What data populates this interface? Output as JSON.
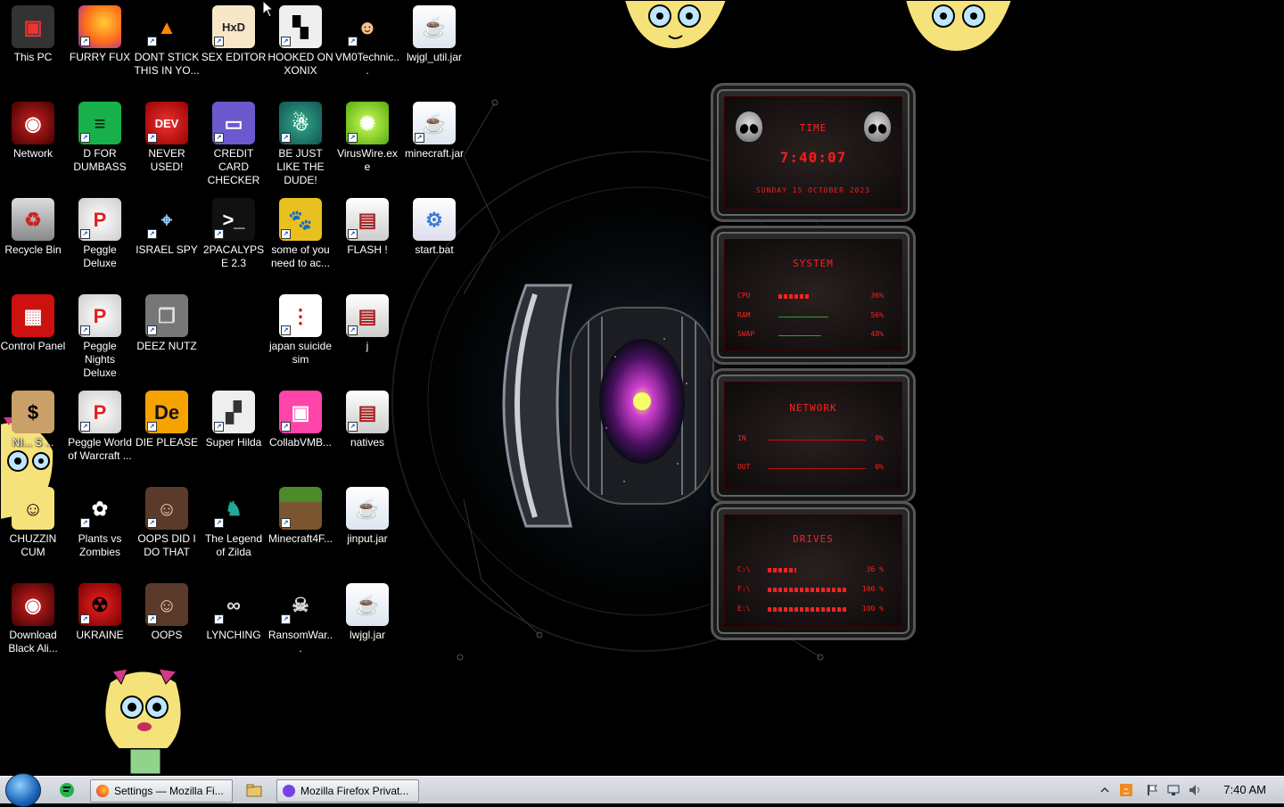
{
  "desktop": {
    "icons": [
      {
        "label": "This PC",
        "glyph": "pc-icon"
      },
      {
        "label": "FURRY FUX",
        "glyph": "firefox-icon"
      },
      {
        "label": "DONT STICK THIS IN YO...",
        "glyph": "vlc-icon"
      },
      {
        "label": "SEX EDITOR",
        "glyph": "hxd-icon"
      },
      {
        "label": "HOOKED ON XONIX",
        "glyph": "xonix-icon"
      },
      {
        "label": "VM0Technic...",
        "glyph": "doctor-icon"
      },
      {
        "label": "lwjgl_util.jar",
        "glyph": "java-icon"
      },
      {
        "label": "Network",
        "glyph": "alien-icon"
      },
      {
        "label": "D FOR DUMBASS",
        "glyph": "notepad-icon"
      },
      {
        "label": "NEVER USED!",
        "glyph": "devcpp-icon"
      },
      {
        "label": "CREDIT CARD CHECKER",
        "glyph": "card-icon"
      },
      {
        "label": "BE JUST LIKE THE DUDE!",
        "glyph": "santa-icon"
      },
      {
        "label": "VirusWire.exe",
        "glyph": "lime-icon"
      },
      {
        "label": "minecraft.jar",
        "glyph": "java-icon"
      },
      {
        "label": "Recycle Bin",
        "glyph": "recycle-bin-icon"
      },
      {
        "label": "Peggle Deluxe",
        "glyph": "peggle-icon"
      },
      {
        "label": "ISRAEL SPY",
        "glyph": "spy-icon"
      },
      {
        "label": "2PACALYPSE 2.3",
        "glyph": "terminal-icon"
      },
      {
        "label": "some of you need to ac...",
        "glyph": "beaver-icon"
      },
      {
        "label": "FLASH !",
        "glyph": "folder-icon"
      },
      {
        "label": "start.bat",
        "glyph": "gear-icon"
      },
      {
        "label": "Control Panel",
        "glyph": "control-panel-icon"
      },
      {
        "label": "Peggle Nights Deluxe",
        "glyph": "peggle-icon"
      },
      {
        "label": "DEEZ NUTZ",
        "glyph": "copies-icon"
      },
      {
        "label": "japan suicide sim",
        "glyph": "document-icon"
      },
      {
        "label": "j",
        "glyph": "folder-icon"
      },
      {
        "label": "NI... S ...",
        "glyph": "money-icon"
      },
      {
        "label": "Peggle World of Warcraft ...",
        "glyph": "peggle-icon"
      },
      {
        "label": "DIE PLEASE",
        "glyph": "de-icon"
      },
      {
        "label": "Super Hilda",
        "glyph": "pixel-icon"
      },
      {
        "label": "CollabVMB...",
        "glyph": "computer-icon"
      },
      {
        "label": "natives",
        "glyph": "folder-icon"
      },
      {
        "label": "CHUZZIN CUM",
        "glyph": "chuzzle-icon"
      },
      {
        "label": "Plants vs Zombies",
        "glyph": "flower-icon"
      },
      {
        "label": "OOPS DID I DO THAT",
        "glyph": "portrait-icon"
      },
      {
        "label": "The Legend of Zilda",
        "glyph": "elf-icon"
      },
      {
        "label": "Minecraft4F...",
        "glyph": "grass-block-icon"
      },
      {
        "label": "jinput.jar",
        "glyph": "java-icon"
      },
      {
        "label": "Download Black Ali...",
        "glyph": "alien-icon"
      },
      {
        "label": "UKRAINE",
        "glyph": "radiation-icon"
      },
      {
        "label": "OOPS",
        "glyph": "portrait-icon"
      },
      {
        "label": "LYNCHING",
        "glyph": "knot-icon"
      },
      {
        "label": "RansomWar...",
        "glyph": "skull-icon"
      },
      {
        "label": "lwjgl.jar",
        "glyph": "java-icon"
      }
    ]
  },
  "gadget": {
    "time_title": "TIME",
    "time": "7:40:07",
    "date": "SUNDAY 15 OCTOBER 2023",
    "system_title": "SYSTEM",
    "system": [
      {
        "label": "CPU",
        "value": "36%",
        "level": 0.36
      },
      {
        "label": "RAM",
        "value": "56%",
        "level": 0.56
      },
      {
        "label": "SWAP",
        "value": "48%",
        "level": 0.48
      }
    ],
    "network_title": "NETWORK",
    "network": [
      {
        "label": "IN",
        "value": "0%"
      },
      {
        "label": "OUT",
        "value": "0%"
      }
    ],
    "drives_title": "DRIVES",
    "drives": [
      {
        "label": "C:\\",
        "value": "36 %",
        "level": 0.36
      },
      {
        "label": "F:\\",
        "value": "100 %",
        "level": 1.0
      },
      {
        "label": "E:\\",
        "value": "100 %",
        "level": 1.0
      }
    ]
  },
  "taskbar": {
    "start_icon": "windows-orb-icon",
    "quick_launch_icon": "notepad-icon",
    "buttons": [
      {
        "label": "Settings — Mozilla Fi...",
        "icon": "firefox-icon"
      },
      {
        "label": "Mozilla Firefox Privat...",
        "icon": "private-browsing-icon"
      }
    ],
    "tray_icons": [
      "show-hidden-icon",
      "java-update-icon",
      "action-center-icon",
      "network-icon",
      "volume-icon"
    ],
    "clock": "7:40 AM"
  },
  "colors": {
    "accent_red": "#ff2020",
    "taskbar": "#d0d5db"
  }
}
